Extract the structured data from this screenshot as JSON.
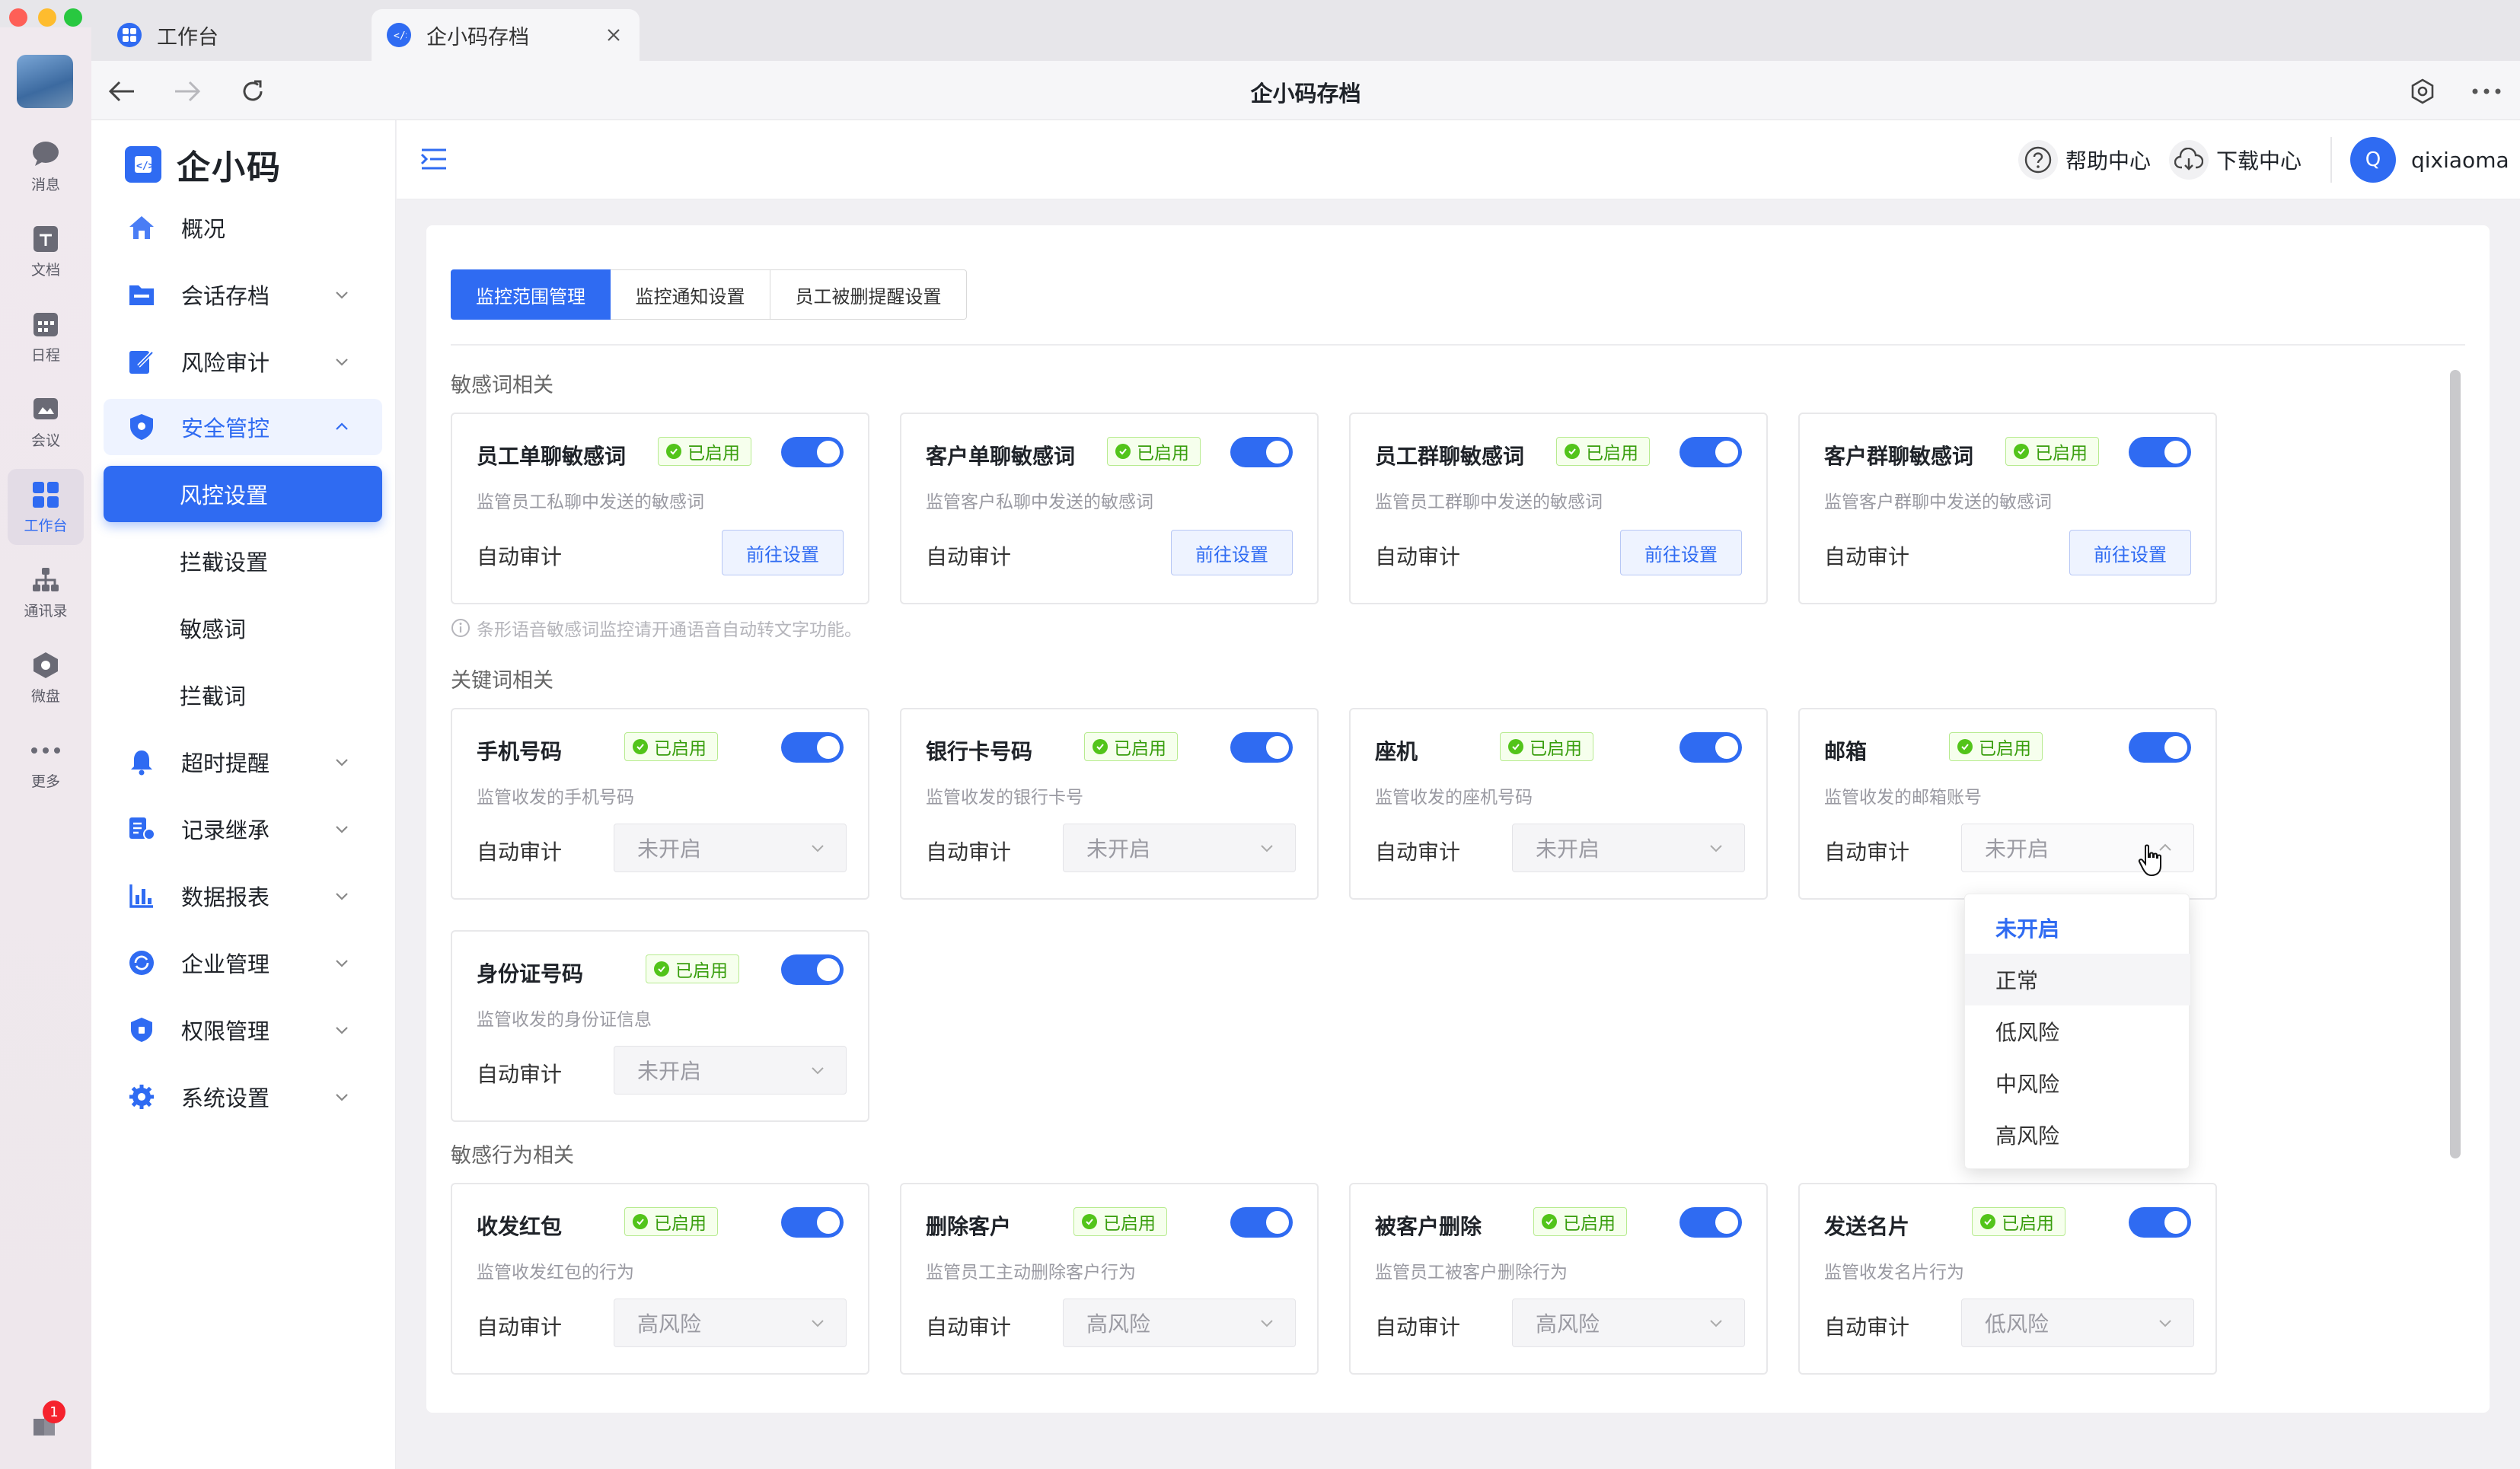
{
  "window": {
    "title": "企小码存档"
  },
  "tabs": [
    {
      "label": "工作台"
    },
    {
      "label": "企小码存档"
    }
  ],
  "rail": {
    "items": [
      {
        "label": "消息"
      },
      {
        "label": "文档"
      },
      {
        "label": "日程"
      },
      {
        "label": "会议"
      },
      {
        "label": "工作台"
      },
      {
        "label": "通讯录"
      },
      {
        "label": "微盘"
      },
      {
        "label": "更多"
      }
    ],
    "notification_count": "1"
  },
  "brand": {
    "logo_text": "企小码"
  },
  "sidebar": {
    "items": [
      {
        "label": "概况"
      },
      {
        "label": "会话存档"
      },
      {
        "label": "风险审计"
      },
      {
        "label": "安全管控"
      },
      {
        "label": "风控设置"
      },
      {
        "label": "拦截设置"
      },
      {
        "label": "敏感词"
      },
      {
        "label": "拦截词"
      },
      {
        "label": "超时提醒"
      },
      {
        "label": "记录继承"
      },
      {
        "label": "数据报表"
      },
      {
        "label": "企业管理"
      },
      {
        "label": "权限管理"
      },
      {
        "label": "系统设置"
      }
    ]
  },
  "header": {
    "help": "帮助中心",
    "download": "下载中心",
    "avatar_letter": "Q",
    "username": "qixiaoma"
  },
  "content_tabs": [
    {
      "label": "监控范围管理"
    },
    {
      "label": "监控通知设置"
    },
    {
      "label": "员工被删提醒设置"
    }
  ],
  "sections": {
    "sensitive_words": {
      "title": "敏感词相关",
      "note": "条形语音敏感词监控请开通语音自动转文字功能。",
      "cards": [
        {
          "title": "员工单聊敏感词",
          "badge": "已启用",
          "desc": "监管员工私聊中发送的敏感词",
          "label": "自动审计",
          "button": "前往设置"
        },
        {
          "title": "客户单聊敏感词",
          "badge": "已启用",
          "desc": "监管客户私聊中发送的敏感词",
          "label": "自动审计",
          "button": "前往设置"
        },
        {
          "title": "员工群聊敏感词",
          "badge": "已启用",
          "desc": "监管员工群聊中发送的敏感词",
          "label": "自动审计",
          "button": "前往设置"
        },
        {
          "title": "客户群聊敏感词",
          "badge": "已启用",
          "desc": "监管客户群聊中发送的敏感词",
          "label": "自动审计",
          "button": "前往设置"
        }
      ]
    },
    "keywords": {
      "title": "关键词相关",
      "cards": [
        {
          "title": "手机号码",
          "badge": "已启用",
          "desc": "监管收发的手机号码",
          "label": "自动审计",
          "select": "未开启"
        },
        {
          "title": "银行卡号码",
          "badge": "已启用",
          "desc": "监管收发的银行卡号",
          "label": "自动审计",
          "select": "未开启"
        },
        {
          "title": "座机",
          "badge": "已启用",
          "desc": "监管收发的座机号码",
          "label": "自动审计",
          "select": "未开启"
        },
        {
          "title": "邮箱",
          "badge": "已启用",
          "desc": "监管收发的邮箱账号",
          "label": "自动审计",
          "select": "未开启"
        },
        {
          "title": "身份证号码",
          "badge": "已启用",
          "desc": "监管收发的身份证信息",
          "label": "自动审计",
          "select": "未开启"
        }
      ]
    },
    "behaviors": {
      "title": "敏感行为相关",
      "cards": [
        {
          "title": "收发红包",
          "badge": "已启用",
          "desc": "监管收发红包的行为",
          "label": "自动审计",
          "select": "高风险"
        },
        {
          "title": "删除客户",
          "badge": "已启用",
          "desc": "监管员工主动删除客户行为",
          "label": "自动审计",
          "select": "高风险"
        },
        {
          "title": "被客户删除",
          "badge": "已启用",
          "desc": "监管员工被客户删除行为",
          "label": "自动审计",
          "select": "高风险"
        },
        {
          "title": "发送名片",
          "badge": "已启用",
          "desc": "监管收发名片行为",
          "label": "自动审计",
          "select": "低风险"
        }
      ]
    }
  },
  "dropdown": {
    "options": [
      "未开启",
      "正常",
      "低风险",
      "中风险",
      "高风险"
    ],
    "selected": "未开启",
    "hovered": "正常"
  },
  "colors": {
    "accent": "#2f6bf2",
    "success": "#52c41a",
    "badge_bg": "#f6ffed"
  }
}
